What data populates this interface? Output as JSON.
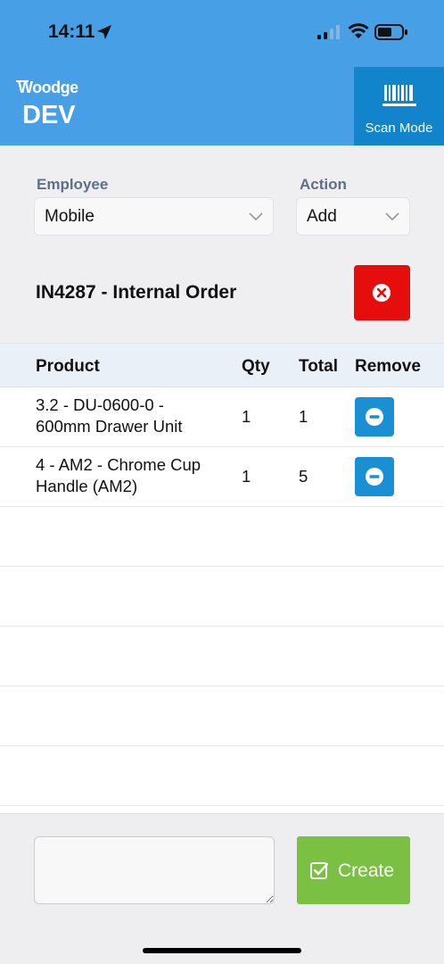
{
  "status_bar": {
    "time": "14:11"
  },
  "header": {
    "logo_brand": "Woodge",
    "logo_env": "DEV",
    "scan_mode_label": "Scan Mode"
  },
  "form": {
    "employee_label": "Employee",
    "employee_value": "Mobile",
    "action_label": "Action",
    "action_value": "Add"
  },
  "order": {
    "title": "IN4287 - Internal Order"
  },
  "table": {
    "headers": {
      "product": "Product",
      "qty": "Qty",
      "total": "Total",
      "remove": "Remove"
    },
    "rows": [
      {
        "product_line1": "3.2 - DU-0600-0 -",
        "product_line2": "600mm Drawer Unit",
        "qty": "1",
        "total": "1"
      },
      {
        "product_line1": "4 - AM2 - Chrome Cup",
        "product_line2": "Handle (AM2)",
        "qty": "1",
        "total": "5"
      }
    ]
  },
  "footer": {
    "note_value": "",
    "create_label": "Create"
  },
  "colors": {
    "header_bg": "#479fe6",
    "scan_btn_bg": "#1284cc",
    "delete_btn": "#e60d0d",
    "remove_btn": "#1a90d4",
    "create_btn": "#7ac143"
  }
}
